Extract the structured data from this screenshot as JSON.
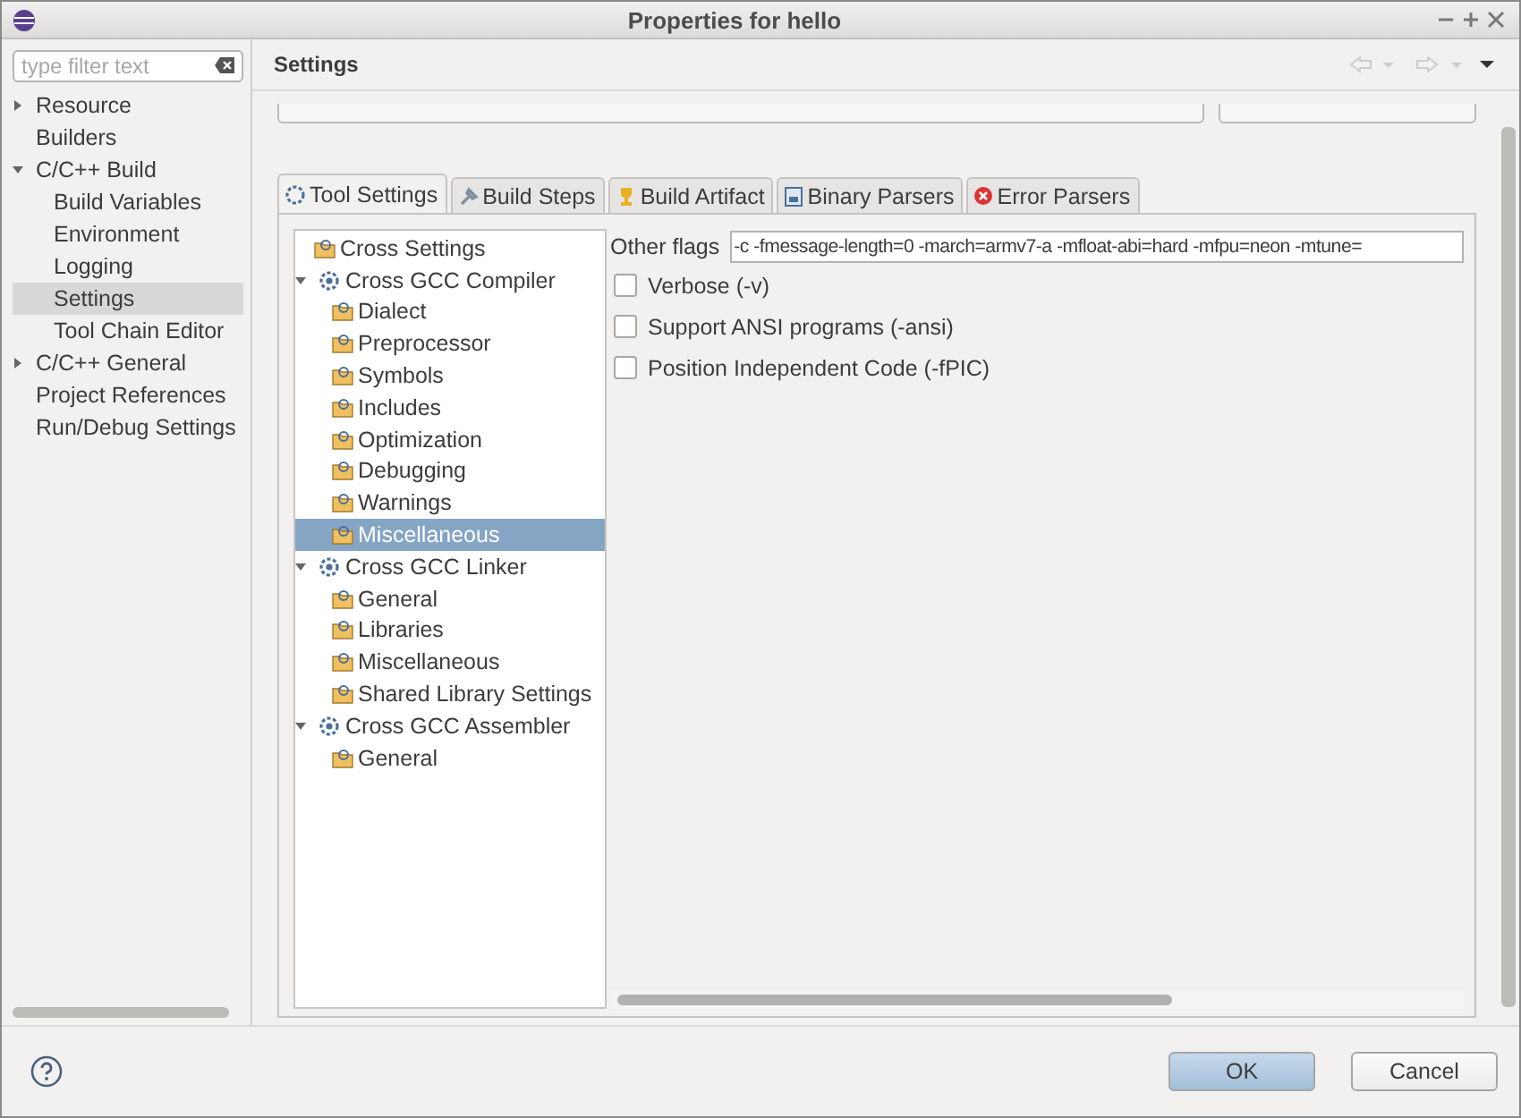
{
  "window": {
    "title": "Properties for hello"
  },
  "filter": {
    "placeholder": "type filter text"
  },
  "sidebar": {
    "items": [
      {
        "label": "Resource",
        "selected": false,
        "expanded": false
      },
      {
        "label": "Builders",
        "selected": false
      },
      {
        "label": "C/C++ Build",
        "selected": false,
        "expanded": true,
        "children": [
          {
            "label": "Build Variables",
            "selected": false
          },
          {
            "label": "Environment",
            "selected": false
          },
          {
            "label": "Logging",
            "selected": false
          },
          {
            "label": "Settings",
            "selected": true
          },
          {
            "label": "Tool Chain Editor",
            "selected": false
          }
        ]
      },
      {
        "label": "C/C++ General",
        "selected": false,
        "expanded": false
      },
      {
        "label": "Project References",
        "selected": false
      },
      {
        "label": "Run/Debug Settings",
        "selected": false
      }
    ]
  },
  "page": {
    "title": "Settings"
  },
  "tabs": [
    {
      "label": "Tool Settings",
      "kind": "tool",
      "selected": true
    },
    {
      "label": "Build Steps",
      "kind": "steps",
      "selected": false
    },
    {
      "label": "Build Artifact",
      "kind": "artifact",
      "selected": false
    },
    {
      "label": "Binary Parsers",
      "kind": "binary",
      "selected": false
    },
    {
      "label": "Error Parsers",
      "kind": "error",
      "selected": false
    }
  ],
  "tool_tree": [
    {
      "label": "Cross Settings",
      "kind": "option",
      "selected": false
    },
    {
      "label": "Cross GCC Compiler",
      "kind": "tool",
      "selected": false,
      "expanded": true,
      "children": [
        {
          "label": "Dialect",
          "kind": "option",
          "selected": false
        },
        {
          "label": "Preprocessor",
          "kind": "option",
          "selected": false
        },
        {
          "label": "Symbols",
          "kind": "option",
          "selected": false
        },
        {
          "label": "Includes",
          "kind": "option",
          "selected": false
        },
        {
          "label": "Optimization",
          "kind": "option",
          "selected": false
        },
        {
          "label": "Debugging",
          "kind": "option",
          "selected": false
        },
        {
          "label": "Warnings",
          "kind": "option",
          "selected": false
        },
        {
          "label": "Miscellaneous",
          "kind": "option",
          "selected": true
        }
      ]
    },
    {
      "label": "Cross GCC Linker",
      "kind": "tool",
      "selected": false,
      "expanded": true,
      "children": [
        {
          "label": "General",
          "kind": "option",
          "selected": false
        },
        {
          "label": "Libraries",
          "kind": "option",
          "selected": false
        },
        {
          "label": "Miscellaneous",
          "kind": "option",
          "selected": false
        },
        {
          "label": "Shared Library Settings",
          "kind": "option",
          "selected": false
        }
      ]
    },
    {
      "label": "Cross GCC Assembler",
      "kind": "tool",
      "selected": false,
      "expanded": true,
      "children": [
        {
          "label": "General",
          "kind": "option",
          "selected": false
        }
      ]
    }
  ],
  "other_flags": {
    "label": "Other flags",
    "value": "-c -fmessage-length=0 -march=armv7-a -mfloat-abi=hard -mfpu=neon -mtune="
  },
  "options": [
    {
      "label": "Verbose (-v)",
      "checked": false
    },
    {
      "label": "Support ANSI programs (-ansi)",
      "checked": false
    },
    {
      "label": "Position Independent Code (-fPIC)",
      "checked": false
    }
  ],
  "buttons": [
    {
      "label": "OK",
      "kind": "primary"
    },
    {
      "label": "Cancel",
      "kind": "secondary"
    }
  ]
}
